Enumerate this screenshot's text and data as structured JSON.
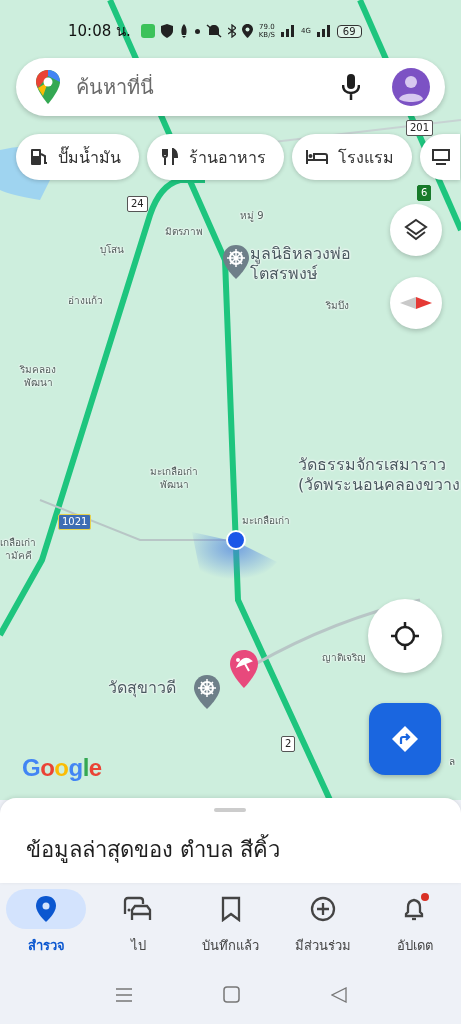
{
  "status_bar": {
    "time": "10:08 น.",
    "speed": "79.0",
    "speed_unit": "KB/S",
    "network": "4G",
    "battery": "69"
  },
  "search": {
    "placeholder": "ค้นหาที่นี่"
  },
  "chips": [
    {
      "label": "ปั๊มน้ำมัน",
      "kind": "fuel"
    },
    {
      "label": "ร้านอาหาร",
      "kind": "food"
    },
    {
      "label": "โรงแรม",
      "kind": "hotel"
    }
  ],
  "map": {
    "labels": [
      {
        "text": "หมู่ 9",
        "kind": "area"
      },
      {
        "text": "มิตรภาพ",
        "kind": "area"
      },
      {
        "text": "บุโสน",
        "kind": "area"
      },
      {
        "text": "อ่างแก้ว",
        "kind": "area"
      },
      {
        "text": "ริมคลอง\nพัฒนา",
        "kind": "area"
      },
      {
        "text": "ริมบึง",
        "kind": "area"
      },
      {
        "text": "มะเกลือเก่า\nพัฒนา",
        "kind": "area"
      },
      {
        "text": "มะเกลือเก่า",
        "kind": "area"
      },
      {
        "text": "เกลือเก่า\nามัคคี",
        "kind": "area"
      },
      {
        "text": "ญาติเจริญ",
        "kind": "area"
      },
      {
        "text": "ล",
        "kind": "area"
      },
      {
        "text": "มูลนิธิหลวงพ่อ\nโตสรพงษ์",
        "kind": "temple"
      },
      {
        "text": "วัดธรรมจักรเสมาราว\n(วัดพระนอนคลองขวาง",
        "kind": "landmark"
      },
      {
        "text": "วัดสุขาวดี",
        "kind": "temple"
      }
    ],
    "shields": [
      {
        "text": "24",
        "kind": "white"
      },
      {
        "text": "201",
        "kind": "white"
      },
      {
        "text": "1021",
        "kind": "blue"
      },
      {
        "text": "2",
        "kind": "white"
      },
      {
        "text": "6",
        "kind": "green"
      }
    ],
    "logo": "Google"
  },
  "sheet": {
    "title": "ข้อมูลล่าสุดของ ตำบล สีคิ้ว"
  },
  "nav": [
    {
      "label": "สำรวจ",
      "kind": "pin",
      "selected": true,
      "notification": false
    },
    {
      "label": "ไป",
      "kind": "commute",
      "selected": false,
      "notification": false
    },
    {
      "label": "บันทึกแล้ว",
      "kind": "bookmark",
      "selected": false,
      "notification": false
    },
    {
      "label": "มีส่วนร่วม",
      "kind": "add",
      "selected": false,
      "notification": false
    },
    {
      "label": "อัปเดต",
      "kind": "bell",
      "selected": false,
      "notification": true
    }
  ]
}
